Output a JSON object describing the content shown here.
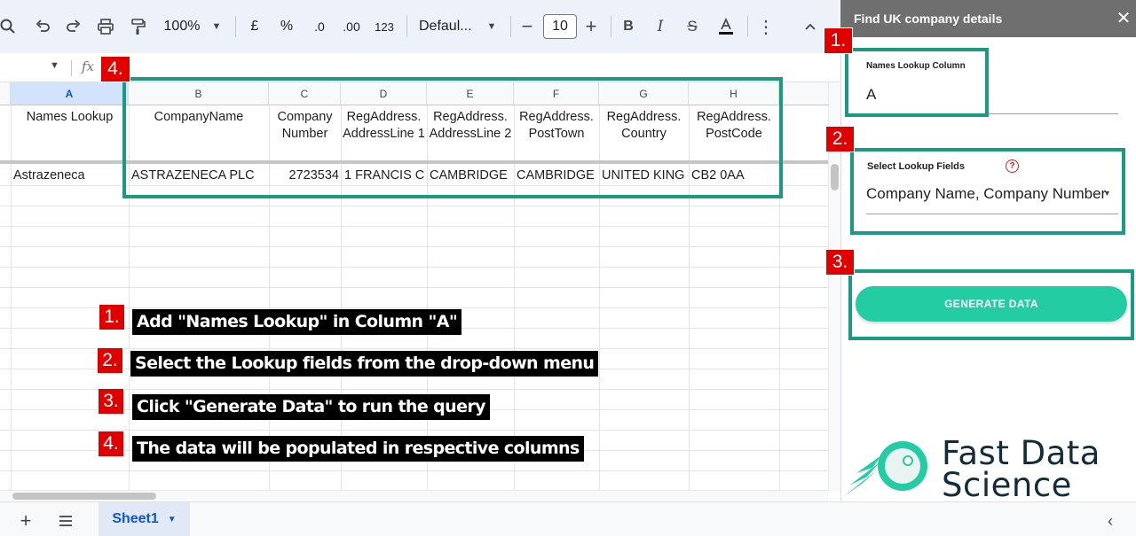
{
  "toolbar": {
    "zoom": "100%",
    "currency": "£",
    "percent": "%",
    "decrease_decimal": ".0",
    "increase_decimal": ".00",
    "number_format": "123",
    "font": "Defaul...",
    "font_size": "10"
  },
  "grid": {
    "columns": [
      "A",
      "B",
      "C",
      "D",
      "E",
      "F",
      "G",
      "H"
    ],
    "header_row": [
      "Names Lookup",
      "CompanyName",
      "Company Number",
      "RegAddress. AddressLine 1",
      "RegAddress. AddressLine 2",
      "RegAddress. PostTown",
      "RegAddress. Country",
      "RegAddress. PostCode"
    ],
    "data_row": [
      "Astrazeneca",
      "ASTRAZENECA PLC",
      "2723534",
      "1 FRANCIS C",
      "CAMBRIDGE",
      "CAMBRIDGE",
      "UNITED KING",
      "CB2 0AA"
    ]
  },
  "sheet_tab": {
    "label": "Sheet1"
  },
  "panel": {
    "title": "Find UK company details",
    "lookup_column_label": "Names Lookup Column",
    "lookup_column_value": "A",
    "fields_label": "Select Lookup Fields",
    "fields_value": "Company Name, Company Number",
    "help": "?",
    "generate_button": "GENERATE DATA"
  },
  "logo": {
    "line1": "Fast Data",
    "line2": "Science"
  },
  "tags": [
    "1.",
    "2.",
    "3.",
    "4."
  ],
  "instructions": [
    "Add \"Names Lookup\" in Column \"A\"",
    "Select the Lookup fields from the drop-down menu",
    "Click \"Generate Data\" to run the query",
    "The data will be populated in respective columns"
  ],
  "colors": {
    "annotation_box": "#1a9a80",
    "tag_red": "#e00000",
    "button_green": "#24cca4"
  }
}
